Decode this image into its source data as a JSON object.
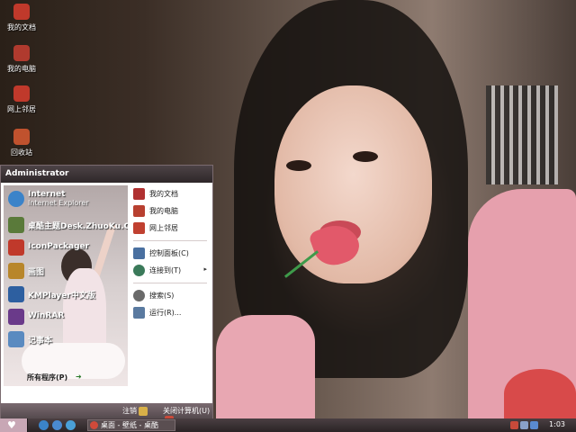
{
  "desktop": {
    "icons": [
      {
        "label": "我的文档",
        "icon": "my-documents-icon",
        "color": "#c0392b"
      },
      {
        "label": "我的电脑",
        "icon": "my-computer-icon",
        "color": "#b03a2e"
      },
      {
        "label": "网上邻居",
        "icon": "network-icon",
        "color": "#c0392b"
      },
      {
        "label": "回收站",
        "icon": "recycle-bin-icon",
        "color": "#c0522e"
      }
    ]
  },
  "start_menu": {
    "user": "Administrator",
    "pinned": [
      {
        "label": "Internet",
        "sub": "Internet Explorer",
        "icon": "internet-explorer-icon",
        "color": "#3b83c9"
      },
      {
        "label": "桌酷主题Desk.ZhuoKu.Com",
        "icon": "zhuoku-theme-icon",
        "color": "#5a7a3a"
      },
      {
        "label": "IconPackager",
        "icon": "iconpackager-icon",
        "color": "#c0392b"
      },
      {
        "label": "画图",
        "icon": "paint-icon",
        "color": "#b8862b"
      },
      {
        "label": "KMPlayer中文版",
        "icon": "kmplayer-icon",
        "color": "#2d5fa0"
      },
      {
        "label": "WinRAR",
        "icon": "winrar-icon",
        "color": "#6a3a8a"
      },
      {
        "label": "记事本",
        "icon": "notepad-icon",
        "color": "#5a8ac0"
      }
    ],
    "all_programs": "所有程序(P)",
    "right": [
      {
        "label": "我的文档",
        "icon": "my-documents-icon",
        "color": "#b03030"
      },
      {
        "label": "我的电脑",
        "icon": "my-computer-icon",
        "color": "#b84030"
      },
      {
        "label": "网上邻居",
        "icon": "network-icon",
        "color": "#c04030"
      },
      {
        "label": "控制面板(C)",
        "icon": "control-panel-icon",
        "color": "#4a70a0"
      },
      {
        "label": "连接到(T)",
        "icon": "connect-to-icon",
        "color": "#3b7a5a"
      },
      {
        "label": "搜索(S)",
        "icon": "search-icon",
        "color": "#6a6a6a"
      },
      {
        "label": "运行(R)...",
        "icon": "run-icon",
        "color": "#5a7aa0"
      }
    ],
    "logoff": "注销",
    "shutdown": "关闭计算机(U)"
  },
  "taskbar": {
    "task": "桌面 - 壁纸 - 桌酷",
    "clock": "1:03"
  },
  "colors": {
    "accent": "#c8a7b5",
    "taskbar": "#3a3033",
    "menu_header": "#3e3638"
  }
}
